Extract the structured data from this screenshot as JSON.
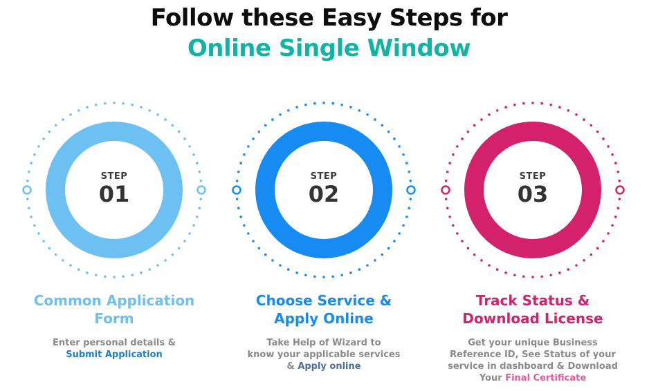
{
  "header": {
    "line1": "Follow these Easy Steps for",
    "line2": "Online Single Window",
    "line2_color": "#12b3a2"
  },
  "steps": [
    {
      "step_label": "STEP",
      "number": "01",
      "color": "#6cc1f2",
      "heading_line1": "Common Application",
      "heading_line2": "Form",
      "desc_line1": "Enter personal details &",
      "desc_line2_highlight": "Submit Application"
    },
    {
      "step_label": "STEP",
      "number": "02",
      "color": "#168bf2",
      "heading_line1": "Choose Service &",
      "heading_line2": "Apply Online",
      "desc_line1": "Take Help of Wizard to",
      "desc_line2": "know your applicable services",
      "desc_line3_prefix": "& ",
      "desc_line3_highlight": "Apply online"
    },
    {
      "step_label": "STEP",
      "number": "03",
      "color": "#d3216b",
      "heading_line1": "Track Status &",
      "heading_line2": "Download License",
      "desc_line1": "Get your unique Business",
      "desc_line2": "Reference ID, See Status of your",
      "desc_line3": "service in dashboard & Download",
      "desc_line4_prefix": "Your ",
      "desc_line4_highlight": "Final Certificate"
    }
  ]
}
